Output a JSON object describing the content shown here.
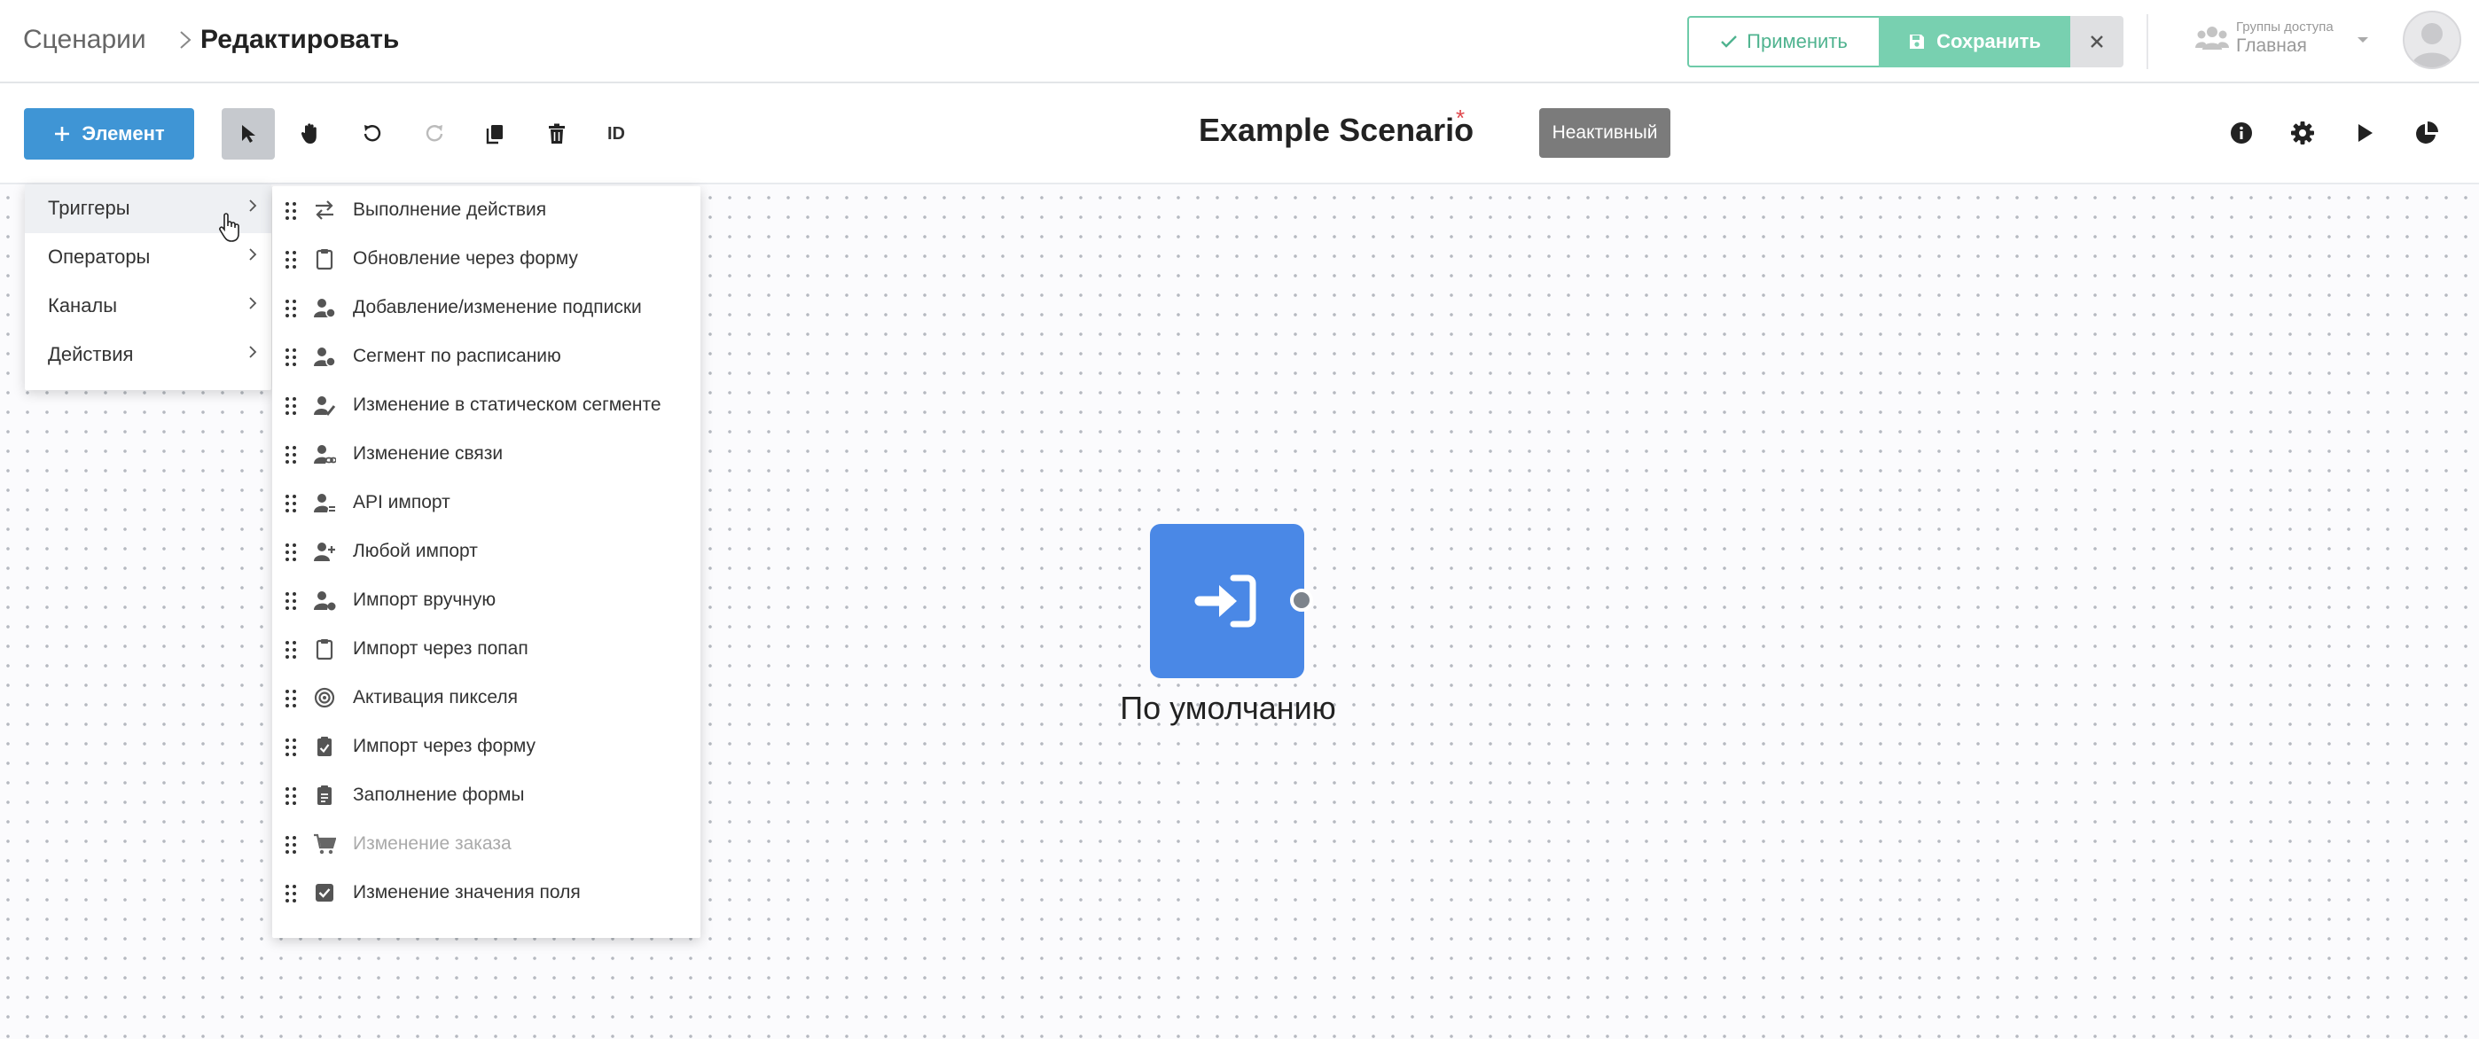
{
  "header": {
    "breadcrumb_root": "Сценарии",
    "breadcrumb_current": "Редактировать",
    "apply_label": "Применить",
    "save_label": "Сохранить",
    "access_label": "Группы доступа",
    "access_value": "Главная"
  },
  "toolbar": {
    "add_element_label": "Элемент",
    "id_label": "ID",
    "scenario_title": "Example Scenario",
    "unsaved_marker": "*",
    "status_badge": "Неактивный",
    "tools": [
      "select-icon",
      "hand-icon",
      "undo-icon",
      "redo-icon",
      "copy-icon",
      "trash-icon"
    ],
    "right_tools": [
      "info-icon",
      "settings-icon",
      "play-icon",
      "stats-icon"
    ]
  },
  "canvas": {
    "node_label": "По умолчанию",
    "node_icon": "login-icon"
  },
  "menu": {
    "items": [
      {
        "label": "Триггеры",
        "highlighted": true
      },
      {
        "label": "Операторы"
      },
      {
        "label": "Каналы"
      },
      {
        "label": "Действия"
      }
    ]
  },
  "submenu": {
    "items": [
      {
        "label": "Выполнение действия",
        "icon": "swap-icon"
      },
      {
        "label": "Обновление через форму",
        "icon": "clipboard-icon"
      },
      {
        "label": "Добавление/изменение подписки",
        "icon": "user-clock-icon"
      },
      {
        "label": "Сегмент по расписанию",
        "icon": "user-clock-icon"
      },
      {
        "label": "Изменение в статическом сегменте",
        "icon": "user-edit-icon"
      },
      {
        "label": "Изменение связи",
        "icon": "user-link-icon"
      },
      {
        "label": "API импорт",
        "icon": "user-api-icon"
      },
      {
        "label": "Любой импорт",
        "icon": "user-plus-icon"
      },
      {
        "label": "Импорт вручную",
        "icon": "user-hand-icon"
      },
      {
        "label": "Импорт через попап",
        "icon": "clipboard-icon"
      },
      {
        "label": "Активация пикселя",
        "icon": "target-icon"
      },
      {
        "label": "Импорт через форму",
        "icon": "clipboard-check-icon"
      },
      {
        "label": "Заполнение формы",
        "icon": "clipboard-list-icon"
      },
      {
        "label": "Изменение заказа",
        "icon": "cart-icon",
        "disabled": true
      },
      {
        "label": "Изменение значения поля",
        "icon": "checkbox-icon"
      }
    ]
  },
  "colors": {
    "primary_blue": "#3f95d5",
    "node_blue": "#4a88e6",
    "save_green": "#78d0b0",
    "apply_green": "#4fb38f",
    "inactive_gray": "#7b7b7b",
    "required_red": "#e0474c"
  }
}
